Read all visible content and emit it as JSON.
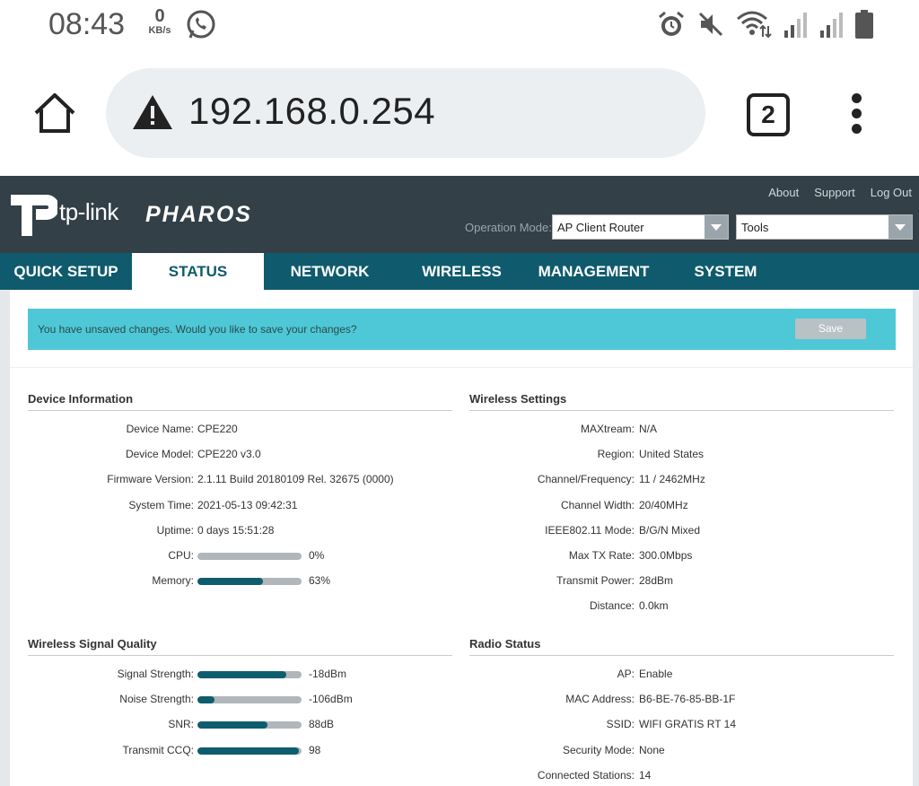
{
  "status_bar": {
    "time": "08:43",
    "net_speed": "0",
    "net_unit": "KB/s"
  },
  "browser": {
    "url": "192.168.0.254",
    "tab_count": "2"
  },
  "router_header": {
    "logo_text": "tp-link",
    "product": "PHAROS",
    "links": [
      "About",
      "Support",
      "Log Out"
    ],
    "operation_mode_label": "Operation Mode:",
    "operation_mode_value": "AP Client Router",
    "tools_value": "Tools"
  },
  "nav": {
    "tabs": [
      "QUICK SETUP",
      "STATUS",
      "NETWORK",
      "WIRELESS",
      "MANAGEMENT",
      "SYSTEM"
    ],
    "active": "STATUS"
  },
  "banner": {
    "message": "You have unsaved changes. Would you like to save your changes?",
    "save_label": "Save"
  },
  "device_info": {
    "title": "Device Information",
    "rows": [
      {
        "label": "Device Name:",
        "value": "CPE220"
      },
      {
        "label": "Device Model:",
        "value": "CPE220 v3.0"
      },
      {
        "label": "Firmware Version:",
        "value": "2.1.11 Build 20180109 Rel. 32675 (0000)"
      },
      {
        "label": "System Time:",
        "value": "2021-05-13 09:42:31"
      },
      {
        "label": "Uptime:",
        "value": "0 days 15:51:28"
      },
      {
        "label": "CPU:",
        "value": "0%",
        "level": 0
      },
      {
        "label": "Memory:",
        "value": "63%",
        "level": 63
      }
    ]
  },
  "wireless_settings": {
    "title": "Wireless Settings",
    "rows": [
      {
        "label": "MAXtream:",
        "value": "N/A"
      },
      {
        "label": "Region:",
        "value": "United States"
      },
      {
        "label": "Channel/Frequency:",
        "value": "11  / 2462MHz"
      },
      {
        "label": "Channel Width:",
        "value": "20/40MHz"
      },
      {
        "label": "IEEE802.11 Mode:",
        "value": "B/G/N Mixed"
      },
      {
        "label": "Max TX Rate:",
        "value": "300.0Mbps"
      },
      {
        "label": "Transmit Power:",
        "value": "28dBm"
      },
      {
        "label": "Distance:",
        "value": "0.0km"
      }
    ]
  },
  "signal_quality": {
    "title": "Wireless Signal Quality",
    "rows": [
      {
        "label": "Signal Strength:",
        "value": "-18dBm",
        "level": 85
      },
      {
        "label": "Noise Strength:",
        "value": "-106dBm",
        "level": 16
      },
      {
        "label": "SNR:",
        "value": "88dB",
        "level": 67
      },
      {
        "label": "Transmit CCQ:",
        "value": "98",
        "level": 97
      }
    ]
  },
  "radio_status": {
    "title": "Radio Status",
    "rows": [
      {
        "label": "AP:",
        "value": "Enable"
      },
      {
        "label": "MAC Address:",
        "value": "B6-BE-76-85-BB-1F"
      },
      {
        "label": "SSID:",
        "value": "WIFI GRATIS RT 14"
      },
      {
        "label": "Security Mode:",
        "value": "None"
      },
      {
        "label": "Connected Stations:",
        "value": "14"
      }
    ]
  },
  "colors": {
    "header_bg": "#334047",
    "nav_bg": "#0f5b6d",
    "banner_bg": "#4ec8d6",
    "bar_fill": "#0e5d6e"
  }
}
